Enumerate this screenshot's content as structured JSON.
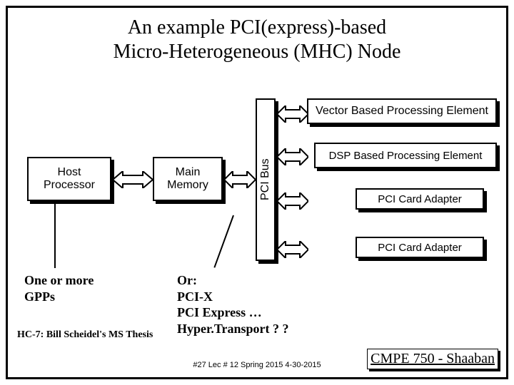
{
  "title_line1": "An example PCI(express)-based",
  "title_line2": "Micro-Heterogeneous (MHC) Node",
  "blocks": {
    "host": "Host\nProcessor",
    "mem": "Main\nMemory",
    "pci_bus": "PCI Bus",
    "vector": "Vector Based Processing Element",
    "dsp": "DSP Based Processing Element",
    "adapter1": "PCI Card Adapter",
    "adapter2": "PCI Card Adapter"
  },
  "annotations": {
    "gpps": "One or more\nGPPs",
    "or_list": "Or:\nPCI-X\nPCI Express …\nHyper.Transport ? ?"
  },
  "thesis": "HC-7: Bill Scheidel's MS Thesis",
  "footer": "#27   Lec # 12   Spring 2015  4-30-2015",
  "course": "CMPE 750 - Shaaban"
}
